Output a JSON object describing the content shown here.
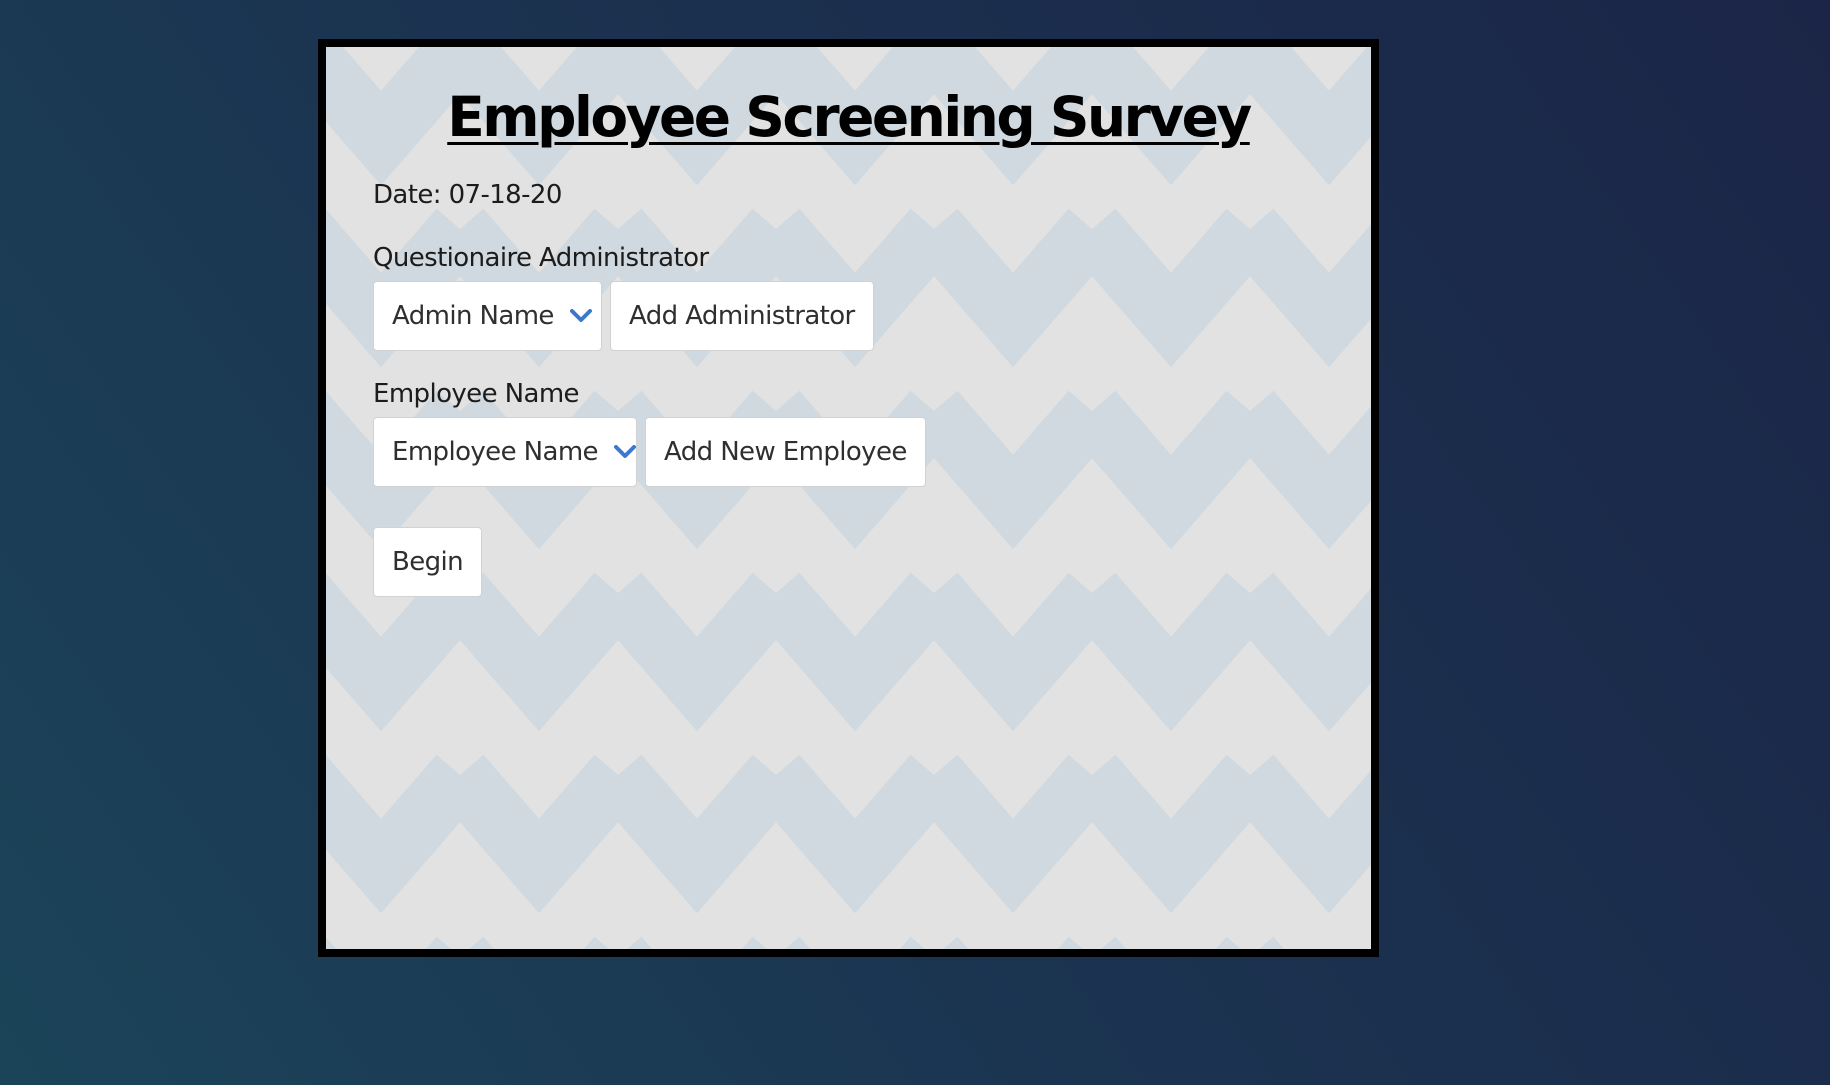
{
  "survey": {
    "title": "Employee Screening Survey",
    "date_text": "Date: 07-18-20",
    "administrator": {
      "label": "Questionaire Administrator",
      "select_value": "Admin Name",
      "add_button": "Add Administrator"
    },
    "employee": {
      "label": "Employee Name",
      "select_value": "Employee Name",
      "add_button": "Add New Employee"
    },
    "begin_button": "Begin"
  },
  "colors": {
    "chevron_accent": "#3b78d0",
    "pattern_light": "#e2e2e2",
    "pattern_dark": "#d0d9df",
    "card_border": "#000000"
  },
  "icons": {
    "select_dropdown": "chevron-down-icon"
  }
}
